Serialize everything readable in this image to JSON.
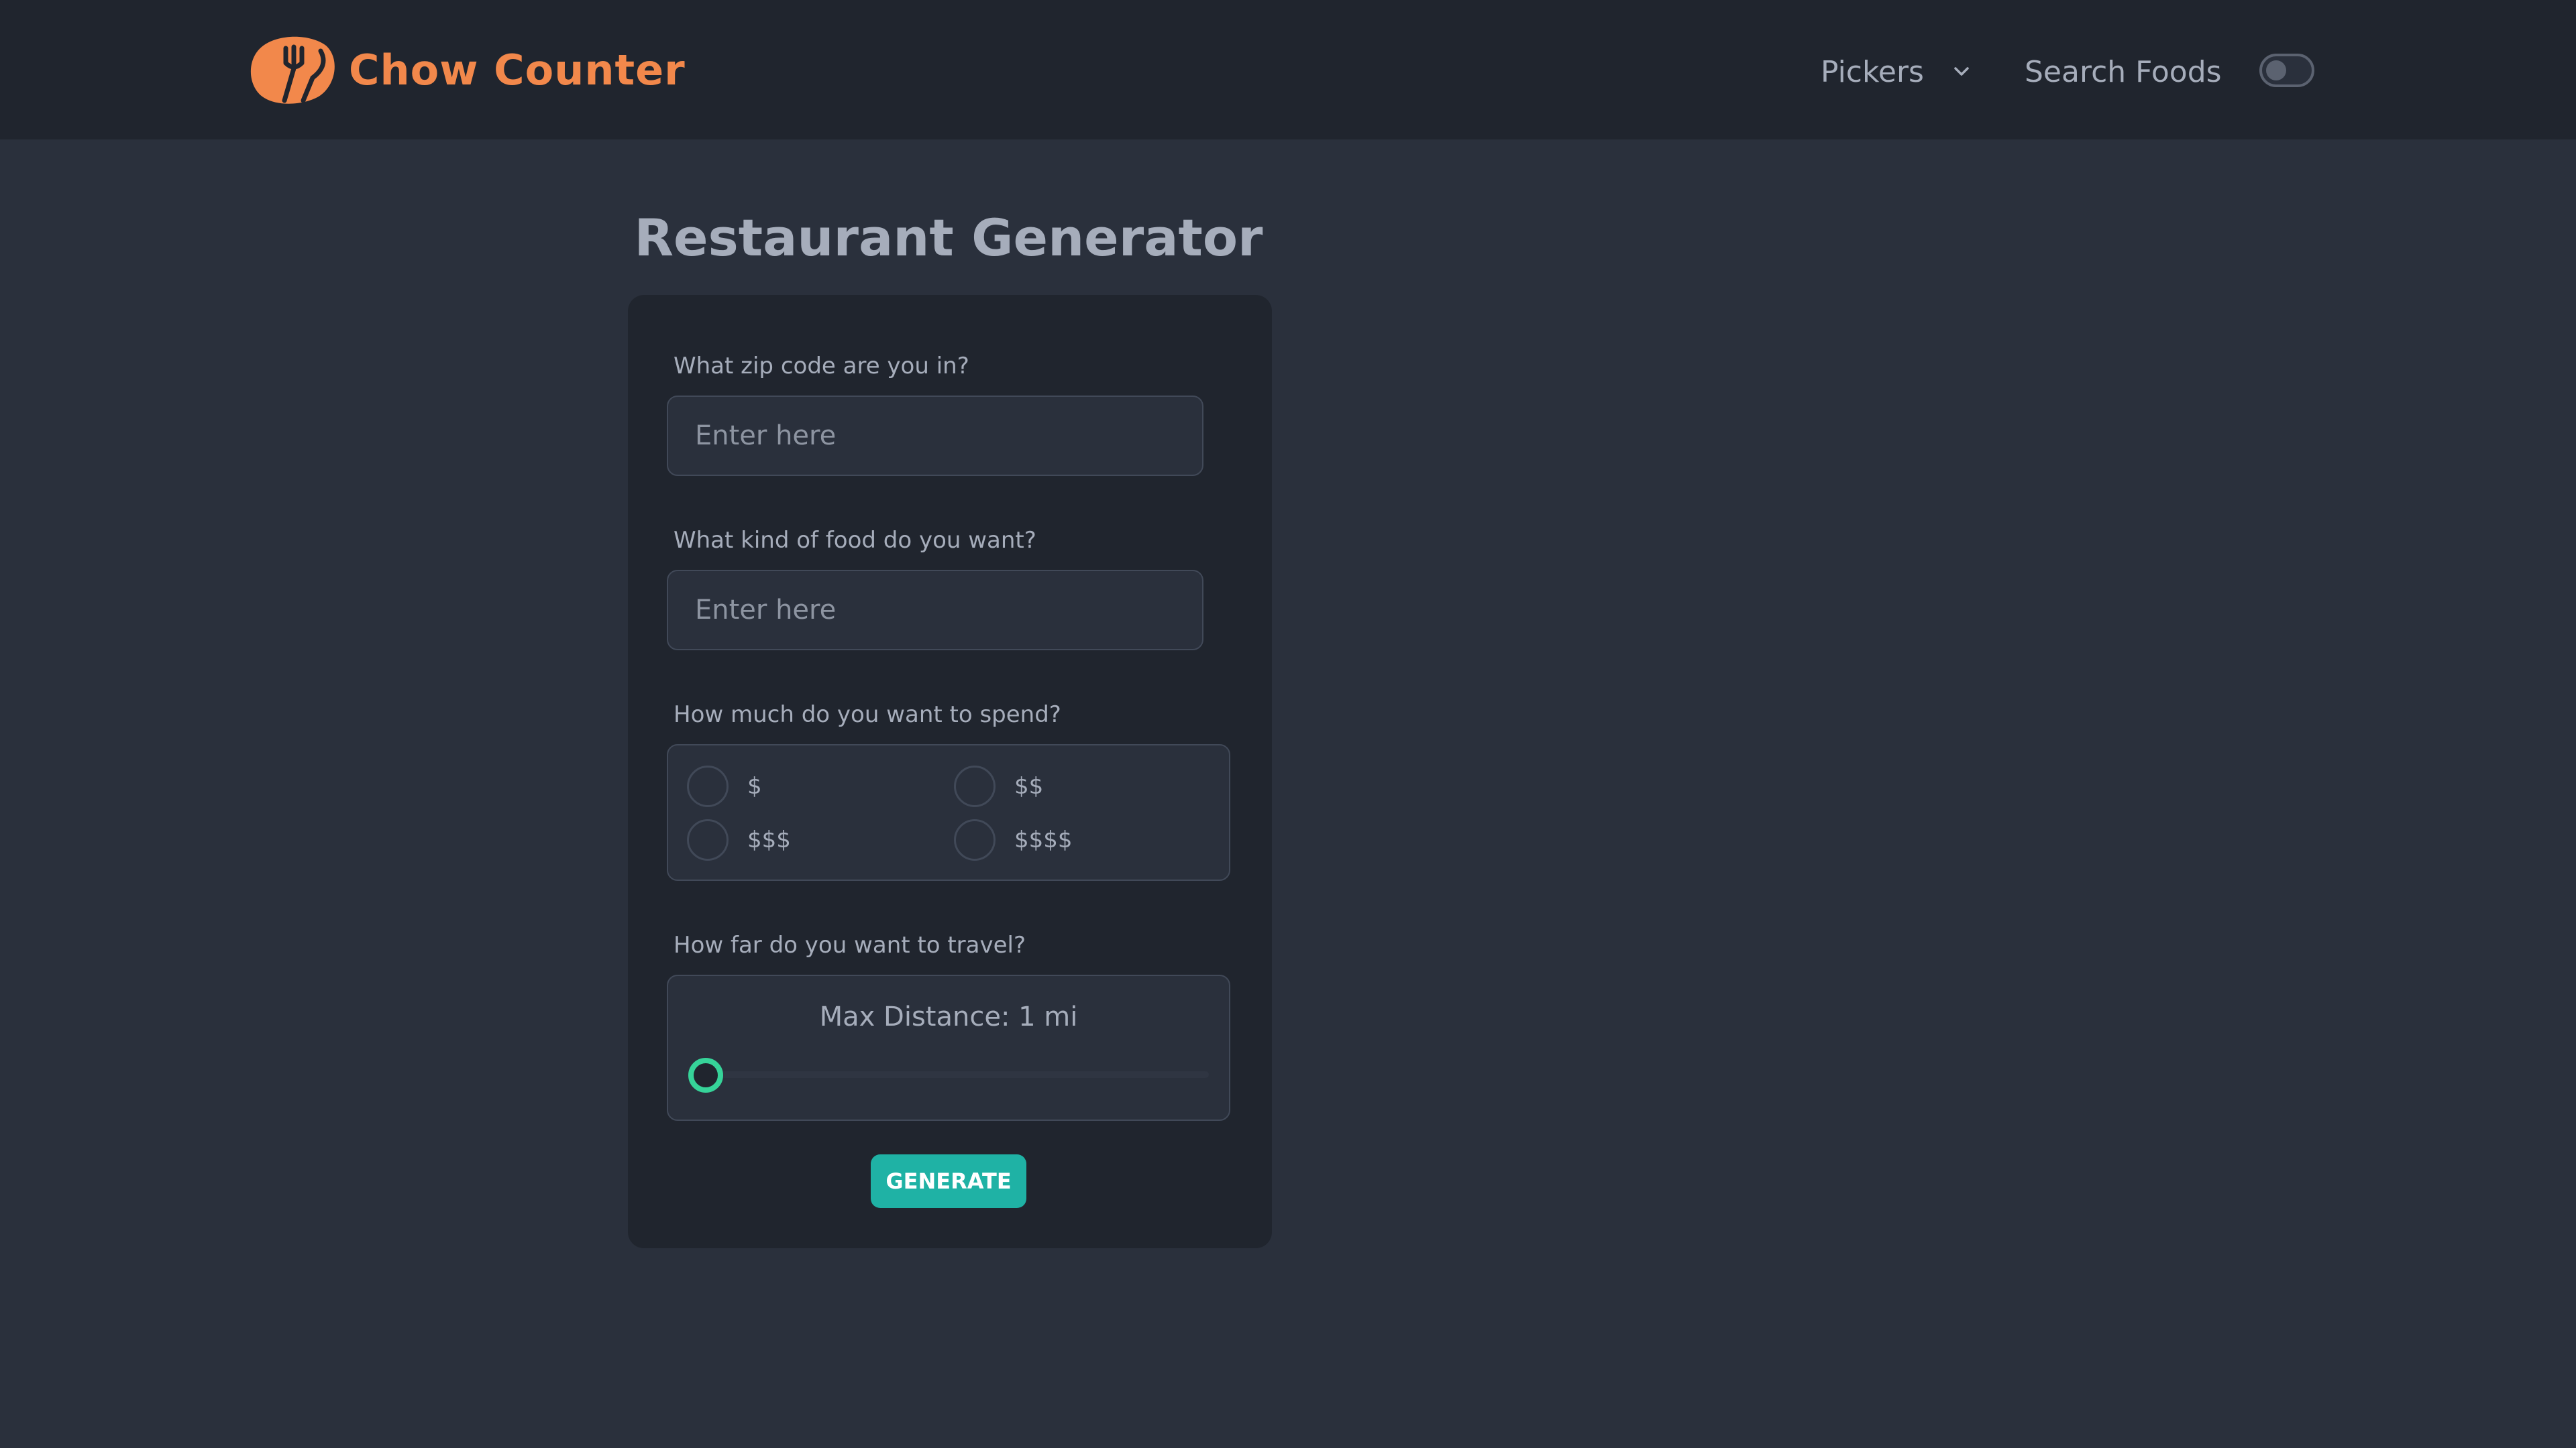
{
  "brand": {
    "name": "Chow Counter",
    "accent": "#f2884b"
  },
  "nav": {
    "pickers_label": "Pickers",
    "search_label": "Search Foods",
    "theme_toggle_on": false
  },
  "page": {
    "title": "Restaurant Generator"
  },
  "form": {
    "zip": {
      "label": "What zip code are you in?",
      "placeholder": "Enter here",
      "value": ""
    },
    "food": {
      "label": "What kind of food do you want?",
      "placeholder": "Enter here",
      "value": ""
    },
    "spend": {
      "label": "How much do you want to spend?",
      "options": [
        "$",
        "$$",
        "$$$",
        "$$$$"
      ],
      "selected": null
    },
    "distance": {
      "label": "How far do you want to travel?",
      "caption": "Max Distance: 1 mi",
      "value": 1
    },
    "generate_label": "Generate"
  },
  "colors": {
    "background": "#2a303c",
    "card": "#20252e",
    "primary": "#1fb2a5",
    "slider_accent": "#36d399"
  }
}
